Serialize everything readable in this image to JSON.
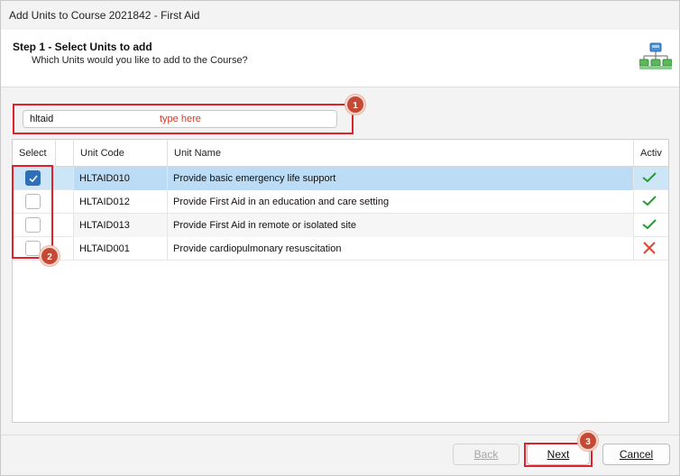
{
  "window": {
    "title": "Add Units to Course 2021842 - First Aid"
  },
  "header": {
    "step_title": "Step 1 - Select Units to add",
    "step_subtitle": "Which Units would you like to add to the Course?",
    "icon": "hierarchy-icon"
  },
  "search": {
    "value": "hltaid",
    "hint": "type here"
  },
  "callouts": {
    "one": "1",
    "two": "2",
    "three": "3"
  },
  "grid": {
    "columns": {
      "select": "Select",
      "code": "Unit Code",
      "name": "Unit Name",
      "active": "Activ"
    },
    "rows": [
      {
        "checked": true,
        "code": "HLTAID010",
        "name": "Provide basic emergency life support",
        "active": true
      },
      {
        "checked": false,
        "code": "HLTAID012",
        "name": "Provide First Aid in an education and care setting",
        "active": true
      },
      {
        "checked": false,
        "code": "HLTAID013",
        "name": "Provide First Aid in remote or isolated site",
        "active": true
      },
      {
        "checked": false,
        "code": "HLTAID001",
        "name": "Provide cardiopulmonary resuscitation",
        "active": false
      }
    ]
  },
  "buttons": {
    "back": "Back",
    "next": "Next",
    "cancel": "Cancel"
  },
  "colors": {
    "highlight": "#e0212b",
    "callout": "#c44a35",
    "check_green": "#1fa02a",
    "cross_red": "#e2452f",
    "selected_row": "#cde6f7"
  }
}
